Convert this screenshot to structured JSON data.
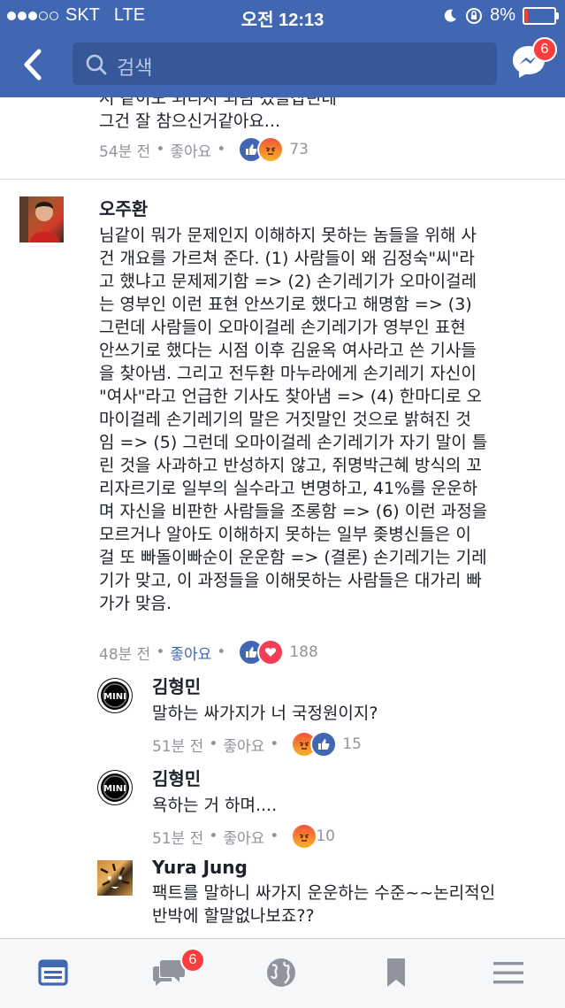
{
  "status_bar": {
    "carrier": "SKT",
    "network": "LTE",
    "time": "오전 12:13",
    "battery": "8%"
  },
  "nav": {
    "search_placeholder": "검색",
    "messenger_badge": "6"
  },
  "colors": {
    "brand": "#4267b2",
    "badge": "#fa3e3e",
    "meta": "#90949c"
  },
  "comments": [
    {
      "partial_text_line1": "저 같이도 되디지 되림 겄을잡린데",
      "partial_text_line2": "그건 잘 참으신거같아요...",
      "time": "54분 전",
      "like_label": "좋아요",
      "reactions": [
        "like",
        "angry"
      ],
      "count": "73"
    },
    {
      "author": "오주환",
      "lines": [
        "님같이 뭐가 문제인지 이해하지 못하는 놈들을 위해 사",
        "건 개요를 가르쳐 준다. (1) 사람들이 왜 김정숙\"씨\"라",
        "고 했냐고 문제제기함 => (2) 손기레기가 오마이걸레",
        "는 영부인 이런 표현 안쓰기로 했다고 해명함 => (3)",
        "그런데 사람들이 오마이걸레 손기레기가 영부인 표현",
        "안쓰기로 했다는 시점 이후 김윤옥 여사라고 쓴 기사들",
        "을 찾아냄. 그리고 전두환 마누라에게 손기레기 자신이",
        "\"여사\"라고 언급한 기사도 찾아냄 => (4) 한마디로 오",
        "마이걸레 손기레기의 말은 거짓말인 것으로 밝혀진 것",
        "임 => (5) 그런데 오마이걸레 손기레기가 자기 말이 틀",
        "린 것을 사과하고 반성하지 않고, 쥐명박근혜 방식의 꼬",
        "리자르기로 일부의 실수라고 변명하고, 41%를 운운하",
        "며 자신을 비판한 사람들을 조롱함 => (6) 이런 과정을",
        "모르거나 알아도 이해하지 못하는 일부 좆병신들은 이",
        "걸 또 빠돌이빠순이 운운함 => (결론) 손기레기는 기레",
        "기가 맞고, 이 과정들을 이해못하는 사람들은 대가리 빠",
        "가가 맞음."
      ],
      "time": "48분 전",
      "like_label": "좋아요",
      "reactions": [
        "like",
        "love"
      ],
      "count": "188"
    }
  ],
  "replies": [
    {
      "author": "김형민",
      "avatar_text": "MINI",
      "text": "말하는 싸가지가 너 국정원이지?",
      "time": "51분 전",
      "like_label": "좋아요",
      "reactions": [
        "angry",
        "like"
      ],
      "count": "15"
    },
    {
      "author": "김형민",
      "avatar_text": "MINI",
      "text": "욕하는 거 하며....",
      "time": "51분 전",
      "like_label": "좋아요",
      "reactions": [
        "angry"
      ],
      "count": "10"
    },
    {
      "author": "Yura Jung",
      "avatar_text": "",
      "line1": "팩트를 말하니 싸가지 운운하는 수준~~논리적인",
      "line2": "반박에 할말없나보죠??"
    }
  ],
  "tabbar": {
    "items": [
      "news-feed-icon",
      "friend-requests-icon",
      "notifications-globe-icon",
      "saved-bookmark-icon",
      "menu-icon"
    ],
    "requests_badge": "6"
  }
}
